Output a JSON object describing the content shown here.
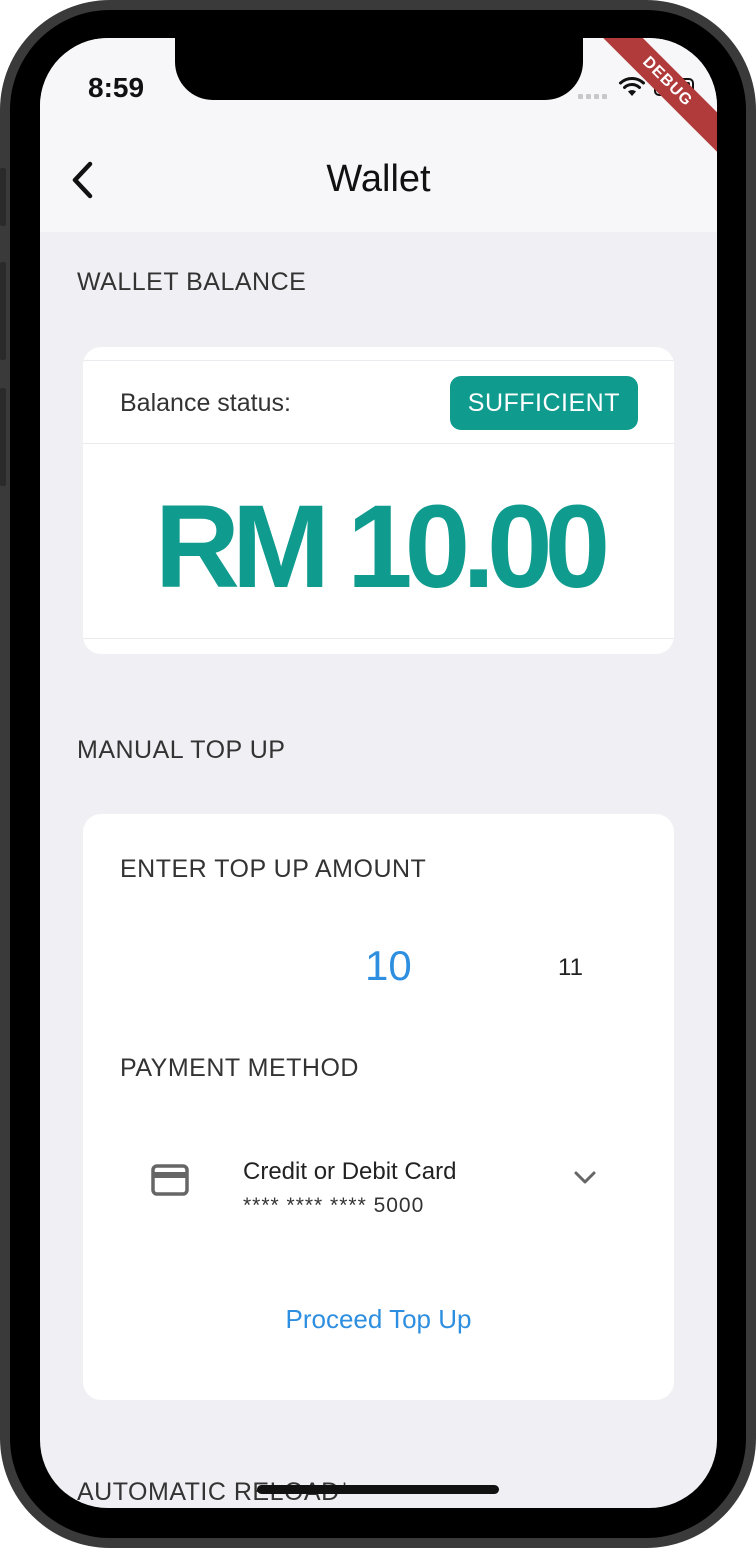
{
  "status_bar": {
    "time": "8:59",
    "debug_banner": "DEBUG"
  },
  "nav": {
    "title": "Wallet",
    "back_icon": "chevron-left-icon"
  },
  "wallet_balance": {
    "section_title": "WALLET BALANCE",
    "status_label": "Balance status:",
    "status_badge": "SUFFICIENT",
    "amount": "RM 10.00"
  },
  "manual_top_up": {
    "section_title": "MANUAL TOP UP",
    "amount_label": "ENTER TOP UP AMOUNT",
    "picker": {
      "selected": "10",
      "next": "11"
    },
    "payment_label": "PAYMENT METHOD",
    "payment_method": {
      "icon": "credit-card-icon",
      "title": "Credit or Debit Card",
      "number": "**** **** **** 5000"
    },
    "proceed_label": "Proceed Top Up"
  },
  "automatic_reload": {
    "section_title": "AUTOMATIC RELOAD*"
  },
  "colors": {
    "accent_teal": "#0f9b8e",
    "link_blue": "#2e8fe0",
    "background": "#efeff4",
    "debug_red": "#b13a3a"
  }
}
